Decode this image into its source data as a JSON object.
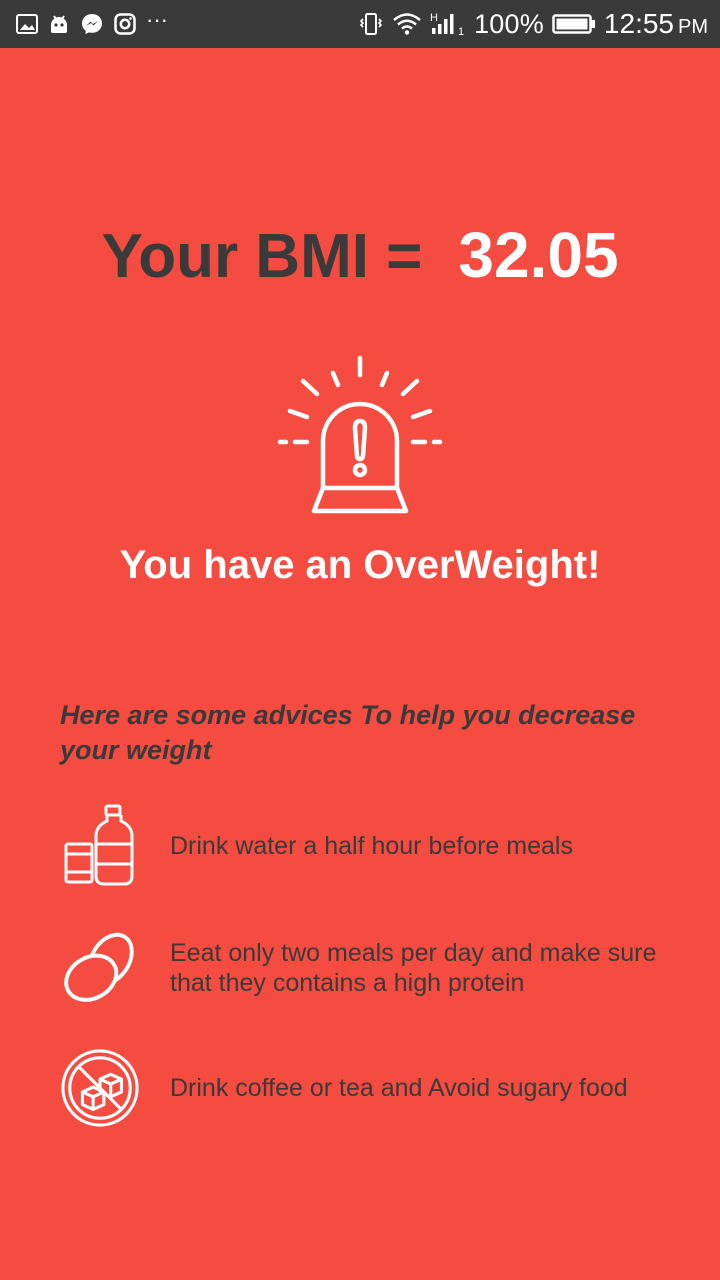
{
  "status_bar": {
    "icons_left": [
      "gallery-icon",
      "android-icon",
      "messenger-icon",
      "instagram-icon"
    ],
    "more": "···",
    "icons_right": [
      "vibrate-icon",
      "wifi-icon",
      "signal-icon"
    ],
    "network_type": "H",
    "sim_slot": "1",
    "battery_percent": "100%",
    "battery_level": 1.0,
    "time": "12:55",
    "ampm": "PM"
  },
  "result": {
    "bmi_label": "Your BMI =",
    "bmi_value": "32.05",
    "status_icon": "siren-alarm-icon",
    "status_message": "You have an OverWeight!"
  },
  "advice": {
    "heading": "Here are some advices To help you decrease your weight",
    "items": [
      {
        "icon": "water-bottle-glass-icon",
        "text": "Drink water a half hour before meals"
      },
      {
        "icon": "eggs-icon",
        "text": "Eeat only two meals per day and make sure that they contains a high protein"
      },
      {
        "icon": "no-sugar-icon",
        "text": "Drink coffee or tea and Avoid sugary food"
      }
    ]
  },
  "colors": {
    "background": "#f44c40",
    "status_bar": "#3a3a3a",
    "dark_text": "#3a3a3a",
    "light_text": "#ffffff"
  }
}
